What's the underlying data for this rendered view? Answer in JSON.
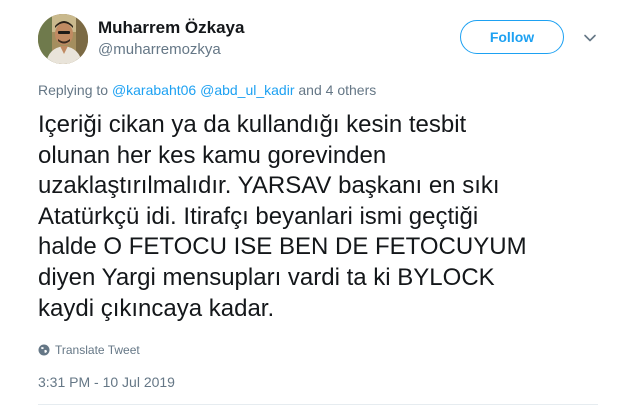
{
  "author": {
    "name": "Muharrem Özkaya",
    "handle": "@muharremozkya",
    "avatar_icon": "profile-photo"
  },
  "follow_button": {
    "label": "Follow",
    "color": "#1da1f2"
  },
  "menu_icon": "chevron-down-icon",
  "replying": {
    "prefix": "Replying to",
    "mentions": [
      "@karabaht06",
      "@abd_ul_kadir"
    ],
    "suffix": "and 4 others"
  },
  "tweet_lines": [
    "Içeriği cikan ya da kullandığı kesin tesbit",
    "olunan her kes kamu gorevinden",
    "uzaklaştırılmalıdır. YARSAV başkanı en sıkı",
    "Atatürkçü idi. Itirafçı beyanlari ismi geçtiği",
    "halde O FETOCU ISE BEN DE FETOCUYUM",
    "diyen Yargi mensupları vardi ta ki BYLOCK",
    "kaydi çıkıncaya kadar."
  ],
  "translate": {
    "label": "Translate Tweet",
    "icon": "globe-icon"
  },
  "timestamp": "3:31 PM - 10 Jul 2019",
  "colors": {
    "link": "#1da1f2",
    "muted": "#657786",
    "text": "#14171a"
  }
}
